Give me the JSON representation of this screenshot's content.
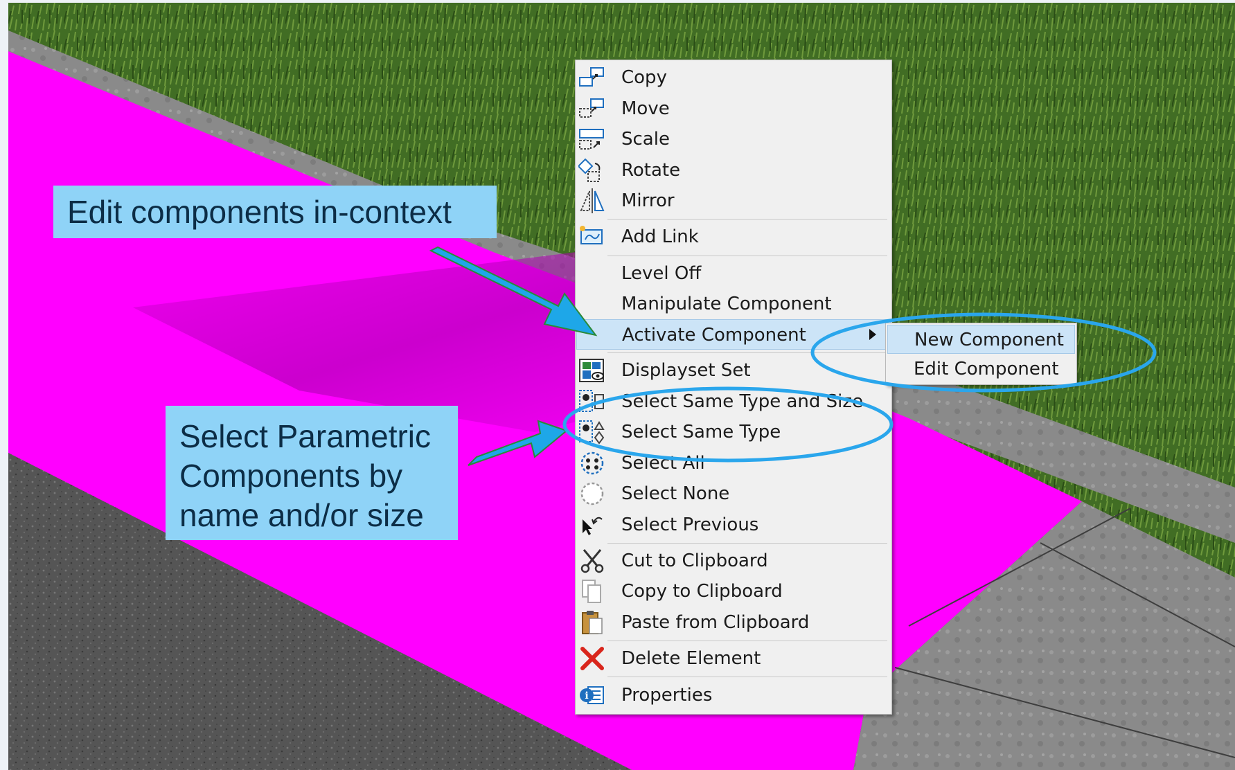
{
  "callouts": {
    "edit_in_context": "Edit components in-context",
    "select_parametric": [
      "Select Parametric",
      "Components by",
      "name and/or size"
    ]
  },
  "context_menu": {
    "items": [
      {
        "label": "Copy",
        "icon": "copy-icon"
      },
      {
        "label": "Move",
        "icon": "move-icon"
      },
      {
        "label": "Scale",
        "icon": "scale-icon"
      },
      {
        "label": "Rotate",
        "icon": "rotate-icon"
      },
      {
        "label": "Mirror",
        "icon": "mirror-icon"
      },
      {
        "label": "Add Link",
        "icon": "link-icon"
      },
      {
        "label": "Level Off",
        "icon": ""
      },
      {
        "label": "Manipulate Component",
        "icon": ""
      },
      {
        "label": "Activate Component",
        "icon": "",
        "submenu": true,
        "highlighted": true
      },
      {
        "label": "Displayset Set",
        "icon": "displayset-icon"
      },
      {
        "label": "Select Same Type and Size",
        "icon": "select-same-type-size-icon"
      },
      {
        "label": "Select Same Type",
        "icon": "select-same-type-icon"
      },
      {
        "label": "Select All",
        "icon": "select-all-icon"
      },
      {
        "label": "Select None",
        "icon": "select-none-icon"
      },
      {
        "label": "Select Previous",
        "icon": "select-previous-icon"
      },
      {
        "label": "Cut to Clipboard",
        "icon": "scissors-icon"
      },
      {
        "label": "Copy to Clipboard",
        "icon": "copy-document-icon"
      },
      {
        "label": "Paste from Clipboard",
        "icon": "clipboard-icon"
      },
      {
        "label": "Delete Element",
        "icon": "delete-x-icon"
      },
      {
        "label": "Properties",
        "icon": "properties-icon"
      }
    ]
  },
  "submenu": {
    "items": [
      {
        "label": "New Component",
        "highlighted": true
      },
      {
        "label": "Edit Component"
      }
    ]
  },
  "colors": {
    "highlight_ellipse": "#2aa6ec",
    "arrow_fill": "#1ea7e8",
    "arrow_outline": "#2c8a3a",
    "callout_bg": "#8fd3f7",
    "menu_highlight": "#cce4f7",
    "element_magenta": "#ff00ff",
    "grass": "#3f6a22"
  }
}
